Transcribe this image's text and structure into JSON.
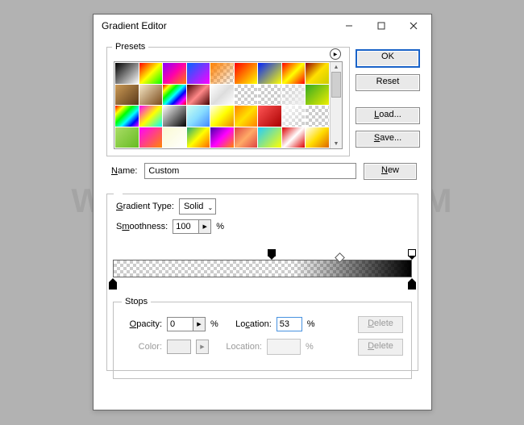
{
  "watermark_text": "WWW.PSD-DUDE.COM",
  "window": {
    "title": "Gradient Editor"
  },
  "buttons": {
    "ok": "OK",
    "reset": "Reset",
    "load": "Load...",
    "save": "Save...",
    "new": "New",
    "delete": "Delete"
  },
  "labels": {
    "presets": "Presets",
    "name": "Name:",
    "gradient_type": "Gradient Type:",
    "smoothness": "Smoothness:",
    "percent": "%",
    "stops": "Stops",
    "opacity": "Opacity:",
    "location": "Location:",
    "color": "Color:"
  },
  "fields": {
    "name_value": "Custom",
    "gradient_type_value": "Solid",
    "smoothness_value": "100",
    "opacity_value": "0",
    "opacity_location_value": "53",
    "color_value": "",
    "color_location_value": ""
  },
  "gradient": {
    "opacity_stops": [
      {
        "pos": 53,
        "selected": true
      },
      {
        "pos": 100,
        "selected": false
      }
    ],
    "color_stops": [
      {
        "pos": 0,
        "color": "#000000"
      },
      {
        "pos": 100,
        "color": "#000000"
      }
    ],
    "midpoints": [
      {
        "pos": 76
      }
    ]
  },
  "presets": [
    "linear-gradient(135deg,#000,#fff)",
    "linear-gradient(135deg,#f00,#ff0,#0f0)",
    "linear-gradient(135deg,#80f,#f0a,#ff8000)",
    "linear-gradient(135deg,#06f,#f0f)",
    "checker|linear-gradient(135deg,#ff8000,rgba(255,128,0,0))",
    "linear-gradient(135deg,#f00,#ff0)",
    "linear-gradient(135deg,#02f,#ff0)",
    "linear-gradient(135deg,#f00,#ff0,#f00)",
    "linear-gradient(135deg,#980000,#ffe000,#cc0)",
    "linear-gradient(135deg,#cc9a55,#5a3a1a)",
    "linear-gradient(135deg,#f6e7c6,#7a4a1a)",
    "linear-gradient(135deg,#f00,#ff0,#0f0,#0ff,#00f,#f0f,#f00)",
    "linear-gradient(135deg,#400,#f88,#400)",
    "linear-gradient(135deg,#fff,#ddd,#fff)",
    "checker",
    "checker",
    "checker|linear-gradient(135deg,rgba(255,255,255,0),#eee)",
    "linear-gradient(135deg,#3a2,#ee0)",
    "linear-gradient(135deg,#f00,#ff0,#0f0,#0ff,#00f,#f0f)",
    "linear-gradient(135deg,#f0f,#ff0,#0ff)",
    "linear-gradient(135deg,#fff,#000)",
    "linear-gradient(135deg,#cfe,#8df,#48f)",
    "linear-gradient(135deg,#ffe,#ff0,#e80)",
    "linear-gradient(135deg,#ff8000,#ffe000,#ff8000)",
    "linear-gradient(135deg,#f55,#a00)",
    "checker|linear-gradient(135deg,rgba(255,255,255,0.9),rgba(255,255,255,0))",
    "checker",
    "linear-gradient(135deg,#ad6,#6b2)",
    "linear-gradient(135deg,#f0f,#f80)",
    "linear-gradient(135deg,#fafad2,#fff)",
    "linear-gradient(135deg,#2a7,#ff0,#f60)",
    "linear-gradient(135deg,#40a,#f0f,#f80)",
    "linear-gradient(135deg,#d44,#fa6,#d44)",
    "linear-gradient(135deg,#2cf,#ff0)",
    "linear-gradient(135deg,#d00,#fff,#d00)",
    "linear-gradient(135deg,#fff,#fd0,#d60)"
  ]
}
